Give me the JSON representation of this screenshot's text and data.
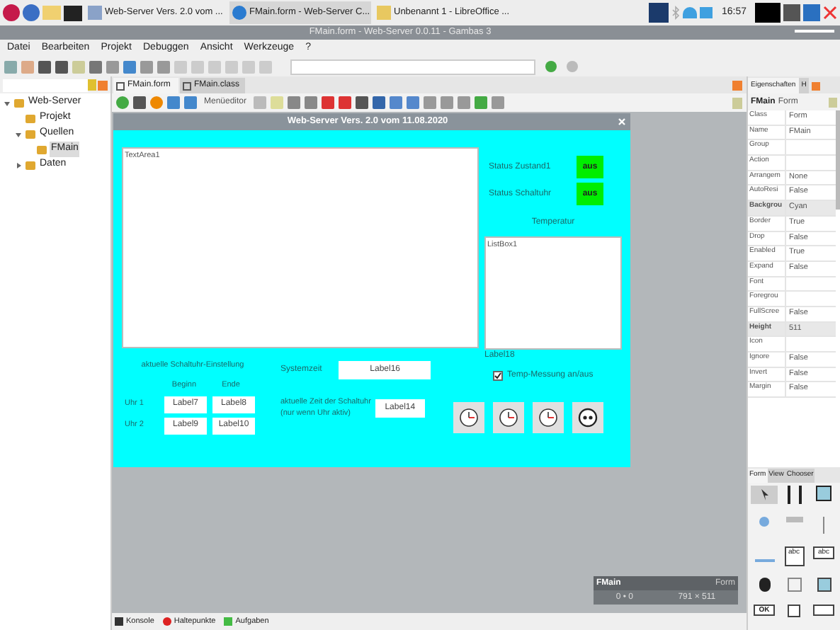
{
  "taskbar": {
    "tasks": [
      {
        "label": "Web-Server Vers. 2.0 vom ...",
        "selected": false
      },
      {
        "label": "FMain.form - Web-Server C...",
        "selected": true
      },
      {
        "label": "Unbenannt 1 - LibreOffice ...",
        "selected": false
      }
    ],
    "clock": "16:57"
  },
  "window": {
    "title": "FMain.form - Web-Server 0.0.11 - Gambas 3"
  },
  "menu": [
    "Datei",
    "Bearbeiten",
    "Projekt",
    "Debuggen",
    "Ansicht",
    "Werkzeuge",
    "?"
  ],
  "project_tree": [
    {
      "label": "Web-Server",
      "expanded": true,
      "selected": false,
      "children": [
        {
          "label": "Projekt",
          "selected": false
        },
        {
          "label": "Quellen",
          "expanded": true,
          "selected": false,
          "children": [
            {
              "label": "FMain",
              "selected": true
            }
          ]
        },
        {
          "label": "Daten",
          "expanded": false,
          "selected": false
        }
      ]
    }
  ],
  "editor_tabs": [
    {
      "label": "FMain.form",
      "selected": true
    },
    {
      "label": "FMain.class",
      "selected": false
    }
  ],
  "form_toolbar": {
    "menu_editor": "Menüeditor"
  },
  "form": {
    "title": "Web-Server Vers. 2.0 vom 11.08.2020",
    "text_area": "TextArea1",
    "status": [
      {
        "label": "Status Zustand1",
        "value": "aus"
      },
      {
        "label": "Status Schaltuhr",
        "value": "aus"
      }
    ],
    "temperature_heading": "Temperatur",
    "list_box": "ListBox1",
    "temperature_label": "Label18",
    "checkbox": {
      "label": "Temp-Messung an/aus",
      "checked": true
    },
    "schedule": {
      "heading": "aktuelle Schaltuhr-Einstellung",
      "columns": [
        "Beginn",
        "Ende"
      ],
      "rows": [
        {
          "label": "Uhr 1",
          "begin": "Label7",
          "end": "Label8"
        },
        {
          "label": "Uhr 2",
          "begin": "Label9",
          "end": "Label10"
        }
      ]
    },
    "system_time": {
      "label": "Systemzeit",
      "value": "Label16"
    },
    "timer_time": {
      "label": "aktuelle Zeit der Schaltuhr",
      "note": "(nur wenn Uhr aktiv)",
      "value": "Label14"
    },
    "buttons": [
      {
        "kind": "clock"
      },
      {
        "kind": "clock"
      },
      {
        "kind": "clock"
      },
      {
        "kind": "socket"
      }
    ]
  },
  "form_info": {
    "name": "FMain",
    "type": "Form",
    "position": "0 • 0",
    "size": "791 × 511"
  },
  "properties": {
    "tabs": [
      {
        "label": "Eigenschaften",
        "selected": true
      },
      {
        "label": "H",
        "selected": false
      }
    ],
    "object": "FMain",
    "class": "Form",
    "rows": [
      {
        "name": "Class",
        "value": "Form",
        "modified": false
      },
      {
        "name": "Name",
        "value": "FMain",
        "modified": false
      },
      {
        "name": "Group",
        "value": "",
        "modified": false
      },
      {
        "name": "Action",
        "value": "",
        "modified": false
      },
      {
        "name": "Arrangem",
        "value": "None",
        "modified": false
      },
      {
        "name": "AutoResi",
        "value": "False",
        "modified": false
      },
      {
        "name": "Backgrou",
        "value": "Cyan",
        "modified": true
      },
      {
        "name": "Border",
        "value": "True",
        "modified": false
      },
      {
        "name": "Drop",
        "value": "False",
        "modified": false
      },
      {
        "name": "Enabled",
        "value": "True",
        "modified": false
      },
      {
        "name": "Expand",
        "value": "False",
        "modified": false
      },
      {
        "name": "Font",
        "value": "",
        "modified": false
      },
      {
        "name": "Foregrou",
        "value": "",
        "modified": false
      },
      {
        "name": "FullScree",
        "value": "False",
        "modified": false
      },
      {
        "name": "Height",
        "value": "511",
        "modified": true
      },
      {
        "name": "Icon",
        "value": "",
        "modified": false
      },
      {
        "name": "Ignore",
        "value": "False",
        "modified": false
      },
      {
        "name": "Invert",
        "value": "False",
        "modified": false
      },
      {
        "name": "Margin",
        "value": "False",
        "modified": false
      }
    ]
  },
  "toolbox": {
    "tabs": [
      {
        "label": "Form",
        "selected": true
      },
      {
        "label": "View",
        "selected": false
      },
      {
        "label": "Chooser",
        "selected": false
      }
    ],
    "ok_label": "OK",
    "abc": "abc",
    "abc_field": "abc"
  },
  "bottom_tabs": [
    "Konsole",
    "Haltepunkte",
    "Aufgaben"
  ]
}
